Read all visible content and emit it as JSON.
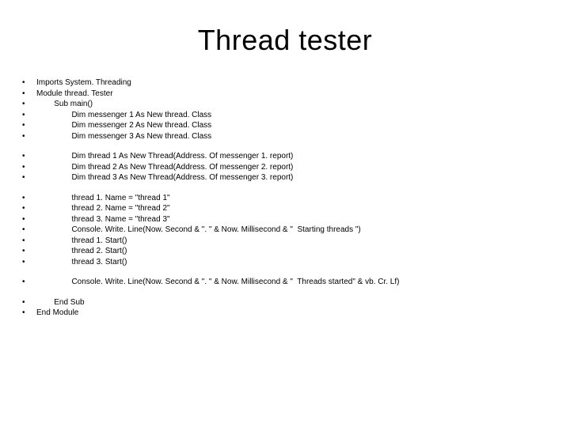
{
  "title": "Thread tester",
  "groups": [
    {
      "lines": [
        {
          "indent": 0,
          "text": "Imports System. Threading"
        },
        {
          "indent": 0,
          "text": "Module thread. Tester"
        },
        {
          "indent": 1,
          "text": "Sub main()"
        },
        {
          "indent": 2,
          "text": "Dim messenger 1 As New thread. Class"
        },
        {
          "indent": 2,
          "text": "Dim messenger 2 As New thread. Class"
        },
        {
          "indent": 2,
          "text": "Dim messenger 3 As New thread. Class"
        }
      ]
    },
    {
      "lines": [
        {
          "indent": 2,
          "text": "Dim thread 1 As New Thread(Address. Of messenger 1. report)"
        },
        {
          "indent": 2,
          "text": "Dim thread 2 As New Thread(Address. Of messenger 2. report)"
        },
        {
          "indent": 2,
          "text": "Dim thread 3 As New Thread(Address. Of messenger 3. report)"
        }
      ]
    },
    {
      "lines": [
        {
          "indent": 2,
          "text": "thread 1. Name = \"thread 1\""
        },
        {
          "indent": 2,
          "text": "thread 2. Name = \"thread 2\""
        },
        {
          "indent": 2,
          "text": "thread 3. Name = \"thread 3\""
        },
        {
          "indent": 2,
          "text": "Console. Write. Line(Now. Second & \". \" & Now. Millisecond & \"  Starting threads \")"
        },
        {
          "indent": 2,
          "text": "thread 1. Start()"
        },
        {
          "indent": 2,
          "text": "thread 2. Start()"
        },
        {
          "indent": 2,
          "text": "thread 3. Start()"
        }
      ]
    },
    {
      "lines": [
        {
          "indent": 2,
          "text": "Console. Write. Line(Now. Second & \". \" & Now. Millisecond & \"  Threads started\" & vb. Cr. Lf)"
        }
      ]
    },
    {
      "lines": [
        {
          "indent": 1,
          "text": "End Sub"
        },
        {
          "indent": 0,
          "text": "End Module"
        }
      ]
    }
  ]
}
